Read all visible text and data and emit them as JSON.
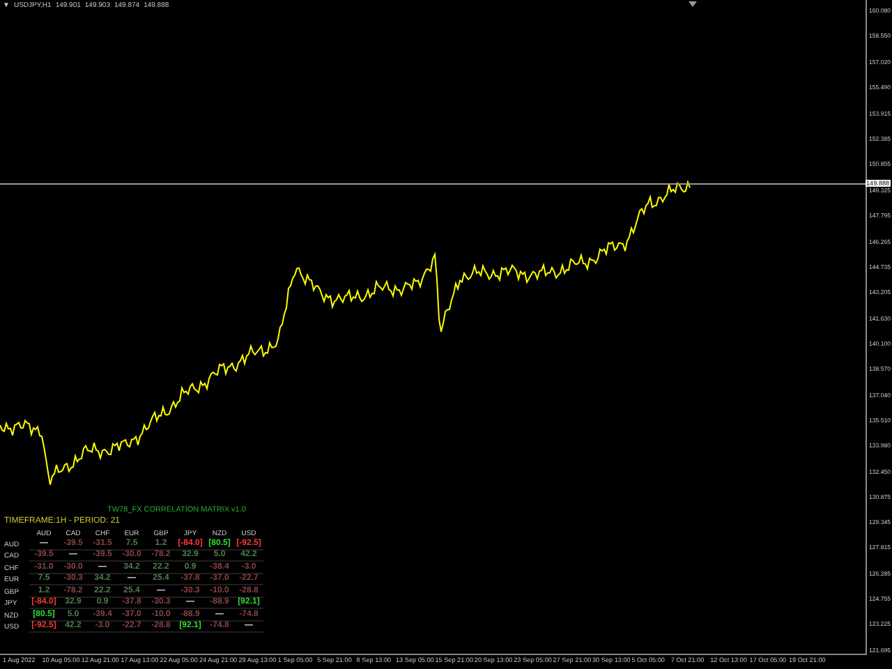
{
  "chart_header": {
    "collapse_glyph": "▼",
    "symbol": "USDJPY,H1",
    "quotes": [
      "149.901",
      "149.903",
      "149.874",
      "149.888"
    ]
  },
  "price_axis": {
    "labels": [
      "160.080",
      "158.550",
      "157.020",
      "155.490",
      "153.915",
      "152.385",
      "150.855",
      "149.325",
      "147.795",
      "146.265",
      "144.735",
      "143.205",
      "141.630",
      "140.100",
      "138.570",
      "137.040",
      "135.510",
      "133.980",
      "132.450",
      "130.875",
      "129.345",
      "127.815",
      "126.285",
      "124.755",
      "123.225",
      "121.695"
    ],
    "current_price": "149.888"
  },
  "time_axis": {
    "labels": [
      "1 Aug 2022",
      "10 Aug 05:00",
      "12 Aug 21:00",
      "17 Aug 13:00",
      "22 Aug 05:00",
      "24 Aug 21:00",
      "29 Aug 13:00",
      "1 Sep 05:00",
      "5 Sep 21:00",
      "8 Sep 13:00",
      "13 Sep 05:00",
      "15 Sep 21:00",
      "20 Sep 13:00",
      "23 Sep 05:00",
      "27 Sep 21:00",
      "30 Sep 13:00",
      "5 Oct 05:00",
      "7 Oct 21:00",
      "12 Oct 13:00",
      "17 Oct 05:00",
      "19 Oct 21:00"
    ]
  },
  "matrix": {
    "title": "TW78_FX CORRELATION MATRIX v1.0",
    "subtitle": "TIMEFRAME:1H - PERIOD: 21",
    "columns": [
      "AUD",
      "CAD",
      "CHF",
      "EUR",
      "GBP",
      "JPY",
      "NZD",
      "USD"
    ],
    "rows": [
      {
        "label": "AUD",
        "cells": [
          {
            "text": "—"
          },
          {
            "text": "-39.5",
            "color": "#8a4444"
          },
          {
            "text": "-31.5",
            "color": "#8a4444"
          },
          {
            "text": "7.5",
            "color": "#4f7f4f"
          },
          {
            "text": "1.2",
            "color": "#4f7f4f"
          },
          {
            "text": "[-84.0]",
            "color": "#ff3838"
          },
          {
            "text": "[80.5]",
            "color": "#33dd33"
          },
          {
            "text": "[-92.5]",
            "color": "#ff3838"
          }
        ]
      },
      {
        "label": "CAD",
        "cells": [
          {
            "text": "-39.5",
            "color": "#8a4444"
          },
          {
            "text": "—"
          },
          {
            "text": "-39.5",
            "color": "#8a4444"
          },
          {
            "text": "-30.0",
            "color": "#8a4444"
          },
          {
            "text": "-78.2",
            "color": "#8a4444"
          },
          {
            "text": "32.9",
            "color": "#4f7f4f"
          },
          {
            "text": "5.0",
            "color": "#4f7f4f"
          },
          {
            "text": "42.2",
            "color": "#4f7f4f"
          }
        ]
      },
      {
        "label": "CHF",
        "cells": [
          {
            "text": "-31.0",
            "color": "#8a4444"
          },
          {
            "text": "-30.0",
            "color": "#8a4444"
          },
          {
            "text": "—"
          },
          {
            "text": "34.2",
            "color": "#4f7f4f"
          },
          {
            "text": "22.2",
            "color": "#4f7f4f"
          },
          {
            "text": "0.9",
            "color": "#4f7f4f"
          },
          {
            "text": "-38.4",
            "color": "#8a4444"
          },
          {
            "text": "-3.0",
            "color": "#8a4444"
          }
        ]
      },
      {
        "label": "EUR",
        "cells": [
          {
            "text": "7.5",
            "color": "#4f7f4f"
          },
          {
            "text": "-30.3",
            "color": "#8a4444"
          },
          {
            "text": "34.2",
            "color": "#4f7f4f"
          },
          {
            "text": "—"
          },
          {
            "text": "25.4",
            "color": "#4f7f4f"
          },
          {
            "text": "-37.8",
            "color": "#8a4444"
          },
          {
            "text": "-37.0",
            "color": "#8a4444"
          },
          {
            "text": "-22.7",
            "color": "#8a4444"
          }
        ]
      },
      {
        "label": "GBP",
        "cells": [
          {
            "text": "1.2",
            "color": "#4f7f4f"
          },
          {
            "text": "-78.2",
            "color": "#8a4444"
          },
          {
            "text": "22.2",
            "color": "#4f7f4f"
          },
          {
            "text": "25.4",
            "color": "#4f7f4f"
          },
          {
            "text": "—"
          },
          {
            "text": "-30.3",
            "color": "#8a4444"
          },
          {
            "text": "-10.0",
            "color": "#8a4444"
          },
          {
            "text": "-28.8",
            "color": "#8a4444"
          }
        ]
      },
      {
        "label": "JPY",
        "cells": [
          {
            "text": "[-84.0]",
            "color": "#ff3838"
          },
          {
            "text": "32.9",
            "color": "#4f7f4f"
          },
          {
            "text": "0.9",
            "color": "#4f7f4f"
          },
          {
            "text": "-37.8",
            "color": "#8a4444"
          },
          {
            "text": "-30.3",
            "color": "#8a4444"
          },
          {
            "text": "—"
          },
          {
            "text": "-88.9",
            "color": "#8a4444"
          },
          {
            "text": "[92.1]",
            "color": "#33dd33"
          }
        ]
      },
      {
        "label": "NZD",
        "cells": [
          {
            "text": "[80.5]",
            "color": "#33dd33"
          },
          {
            "text": "5.0",
            "color": "#4f7f4f"
          },
          {
            "text": "-39.4",
            "color": "#8a4444"
          },
          {
            "text": "-37.0",
            "color": "#8a4444"
          },
          {
            "text": "-10.0",
            "color": "#8a4444"
          },
          {
            "text": "-88.9",
            "color": "#8a4444"
          },
          {
            "text": "—"
          },
          {
            "text": "-74.8",
            "color": "#8a4444"
          }
        ]
      },
      {
        "label": "USD",
        "cells": [
          {
            "text": "[-92.5]",
            "color": "#ff3838"
          },
          {
            "text": "42.2",
            "color": "#4f7f4f"
          },
          {
            "text": "-3.0",
            "color": "#8a4444"
          },
          {
            "text": "-22.7",
            "color": "#8a4444"
          },
          {
            "text": "-28.8",
            "color": "#8a4444"
          },
          {
            "text": "[92.1]",
            "color": "#33dd33"
          },
          {
            "text": "-74.8",
            "color": "#8a4444"
          },
          {
            "text": "—"
          }
        ]
      }
    ]
  }
}
